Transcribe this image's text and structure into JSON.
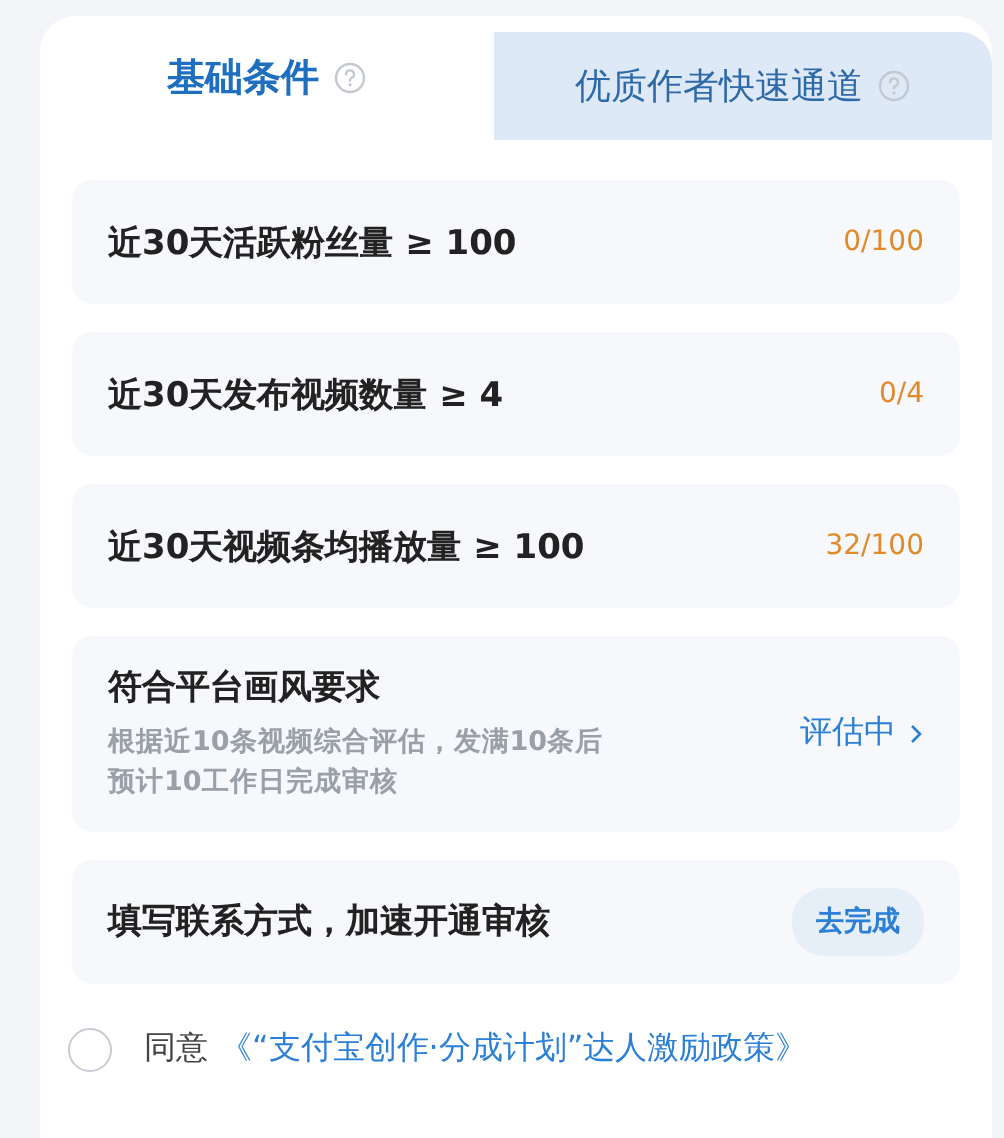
{
  "tabs": [
    {
      "label": "基础条件",
      "selected": true,
      "help": true
    },
    {
      "label": "优质作者快速通道",
      "selected": false,
      "help": true
    }
  ],
  "conditions": [
    {
      "kind": "progress",
      "label": "近30天活跃粉丝量 ≥ 100",
      "value": "0/100"
    },
    {
      "kind": "progress",
      "label": "近30天发布视频数量 ≥ 4",
      "value": "0/4"
    },
    {
      "kind": "progress",
      "label": "近30天视频条均播放量 ≥ 100",
      "value": "32/100"
    },
    {
      "kind": "review",
      "label": "符合平台画风要求",
      "description": "根据近10条视频综合评估，发满10条后预计10工作日完成审核",
      "status": "评估中"
    },
    {
      "kind": "action",
      "label": "填写联系方式，加速开通审核",
      "button": "去完成"
    }
  ],
  "agreement": {
    "checked": false,
    "prefix": "同意",
    "link": "《“支付宝创作·分成计划”达人激励政策》"
  }
}
